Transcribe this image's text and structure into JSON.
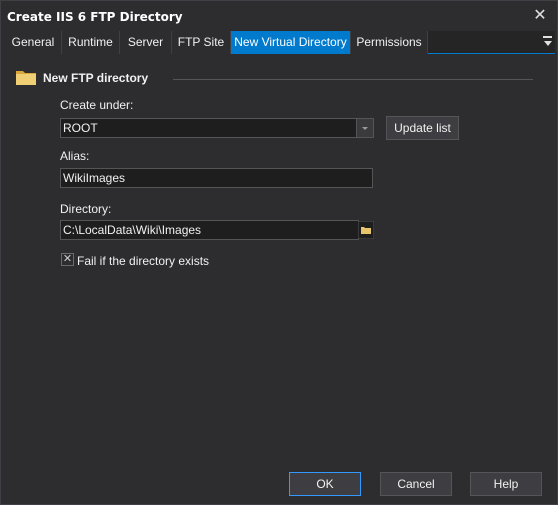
{
  "window": {
    "title": "Create IIS 6 FTP Directory",
    "close_glyph": "✕"
  },
  "tabs": [
    {
      "label": "General"
    },
    {
      "label": "Runtime"
    },
    {
      "label": "Server"
    },
    {
      "label": "FTP Site"
    },
    {
      "label": "New Virtual Directory",
      "active": true
    },
    {
      "label": "Permissions"
    }
  ],
  "group": {
    "title": "New FTP directory",
    "icon": "folder-icon"
  },
  "create_under": {
    "label": "Create under:",
    "value": "ROOT",
    "update_button": "Update list"
  },
  "alias": {
    "label": "Alias:",
    "value": "WikiImages"
  },
  "directory": {
    "label": "Directory:",
    "value": "C:\\LocalData\\Wiki\\Images"
  },
  "fail_if_exists": {
    "label": "Fail if the directory exists",
    "checked": true,
    "check_glyph": "✕"
  },
  "buttons": {
    "ok": "OK",
    "cancel": "Cancel",
    "help": "Help"
  },
  "colors": {
    "background": "#2d2d30",
    "accent": "#007acc",
    "field_bg": "#1e1e1e",
    "folder": "#e8c46a"
  }
}
